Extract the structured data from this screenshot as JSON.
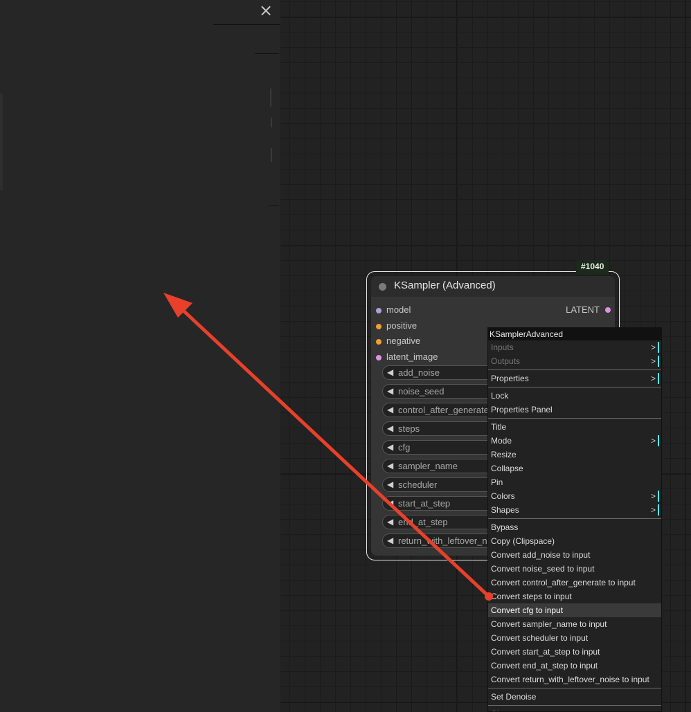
{
  "side_panel": {
    "close_icon": "×"
  },
  "node": {
    "id_badge": "#1040",
    "title": "KSampler (Advanced)",
    "inputs": [
      {
        "label": "model",
        "color": "#b39ddb"
      },
      {
        "label": "positive",
        "color": "#f0a030"
      },
      {
        "label": "negative",
        "color": "#f0a030"
      },
      {
        "label": "latent_image",
        "color": "#e090e0"
      }
    ],
    "output": {
      "label": "LATENT",
      "color": "#e090e0"
    },
    "widgets": [
      "add_noise",
      "noise_seed",
      "control_after_generate",
      "steps",
      "cfg",
      "sampler_name",
      "scheduler",
      "start_at_step",
      "end_at_step",
      "return_with_leftover_noise"
    ]
  },
  "context_menu": {
    "title": "KSamplerAdvanced",
    "groups": [
      [
        {
          "label": "Inputs",
          "disabled": true,
          "submenu": true
        },
        {
          "label": "Outputs",
          "disabled": true,
          "submenu": true
        }
      ],
      [
        {
          "label": "Properties",
          "submenu": true
        }
      ],
      [
        {
          "label": "Lock"
        },
        {
          "label": "Properties Panel"
        }
      ],
      [
        {
          "label": "Title"
        },
        {
          "label": "Mode",
          "submenu": true
        },
        {
          "label": "Resize"
        },
        {
          "label": "Collapse"
        },
        {
          "label": "Pin"
        },
        {
          "label": "Colors",
          "submenu": true
        },
        {
          "label": "Shapes",
          "submenu": true
        }
      ],
      [
        {
          "label": "Bypass"
        },
        {
          "label": "Copy (Clipspace)"
        },
        {
          "label": "Convert add_noise to input"
        },
        {
          "label": "Convert noise_seed to input"
        },
        {
          "label": "Convert control_after_generate to input"
        },
        {
          "label": "Convert steps to input"
        },
        {
          "label": "Convert cfg to input",
          "highlighted": true
        },
        {
          "label": "Convert sampler_name to input"
        },
        {
          "label": "Convert scheduler to input"
        },
        {
          "label": "Convert start_at_step to input"
        },
        {
          "label": "Convert end_at_step to input"
        },
        {
          "label": "Convert return_with_leftover_noise to input"
        }
      ],
      [
        {
          "label": "Set Denoise"
        }
      ],
      [
        {
          "label": "Clone"
        }
      ]
    ],
    "submenu_glyph": ">"
  },
  "annotation": {
    "arrow_color": "#e8402a"
  }
}
